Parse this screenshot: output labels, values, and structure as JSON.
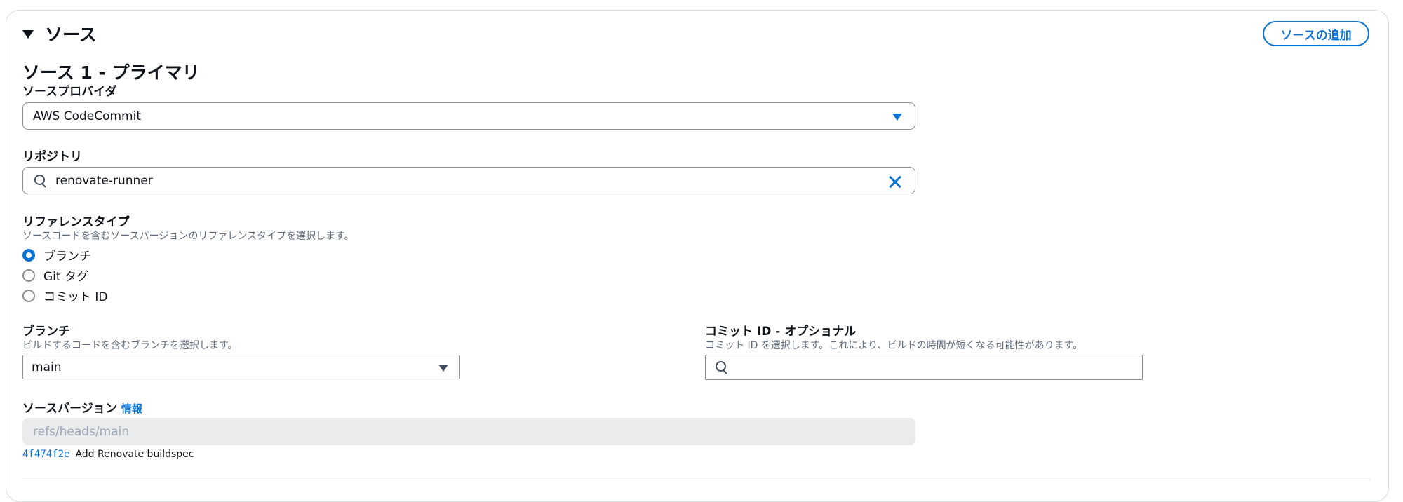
{
  "section": {
    "title": "ソース",
    "add_source_label": "ソースの追加"
  },
  "source1": {
    "heading": "ソース 1 - プライマリ",
    "provider": {
      "label": "ソースプロバイダ",
      "value": "AWS CodeCommit"
    },
    "repository": {
      "label": "リポジトリ",
      "value": "renovate-runner"
    },
    "reference_type": {
      "label": "リファレンスタイプ",
      "description": "ソースコードを含むソースバージョンのリファレンスタイプを選択します。",
      "options": [
        {
          "label": "ブランチ",
          "checked": true
        },
        {
          "label": "Git タグ",
          "checked": false
        },
        {
          "label": "コミット ID",
          "checked": false
        }
      ]
    },
    "branch": {
      "label": "ブランチ",
      "description": "ビルドするコードを含むブランチを選択します。",
      "value": "main"
    },
    "commit_id": {
      "label": "コミット ID - オプショナル",
      "description": "コミット ID を選択します。これにより、ビルドの時間が短くなる可能性があります。",
      "value": ""
    },
    "source_version": {
      "label": "ソースバージョン",
      "info_label": "情報",
      "value": "refs/heads/main",
      "commit_hash": "4f474f2e",
      "commit_message": "Add Renovate buildspec"
    }
  },
  "colors": {
    "accent": "#0972d3",
    "text": "#0f141a",
    "muted": "#5f6b7a",
    "border": "#8c8c94",
    "disabled_bg": "#e9ebed"
  }
}
